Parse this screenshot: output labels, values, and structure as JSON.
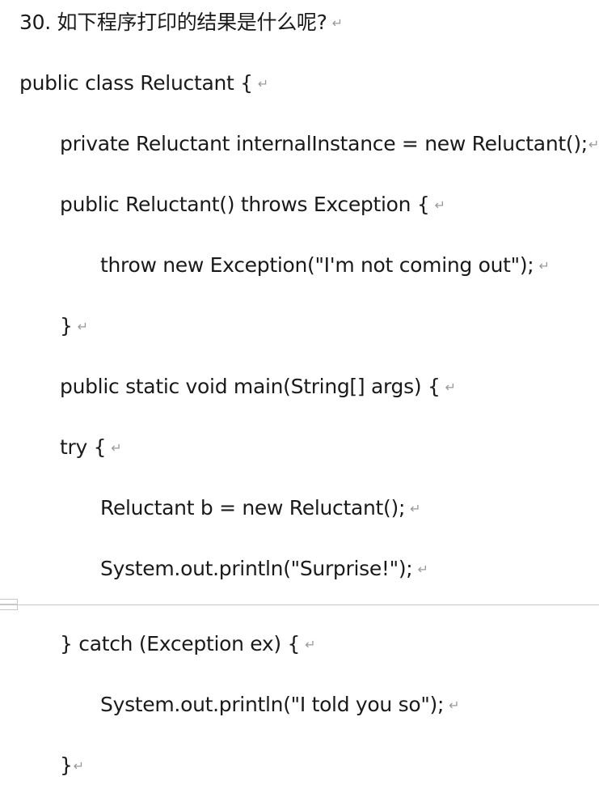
{
  "document": {
    "paragraph_mark": "↵",
    "lines": [
      {
        "text": "30. 如下程序打印的结果是什么呢?"
      },
      {
        "text": "public class Reluctant {"
      },
      {
        "text": "private Reluctant internalInstance = new Reluctant();"
      },
      {
        "text": "public Reluctant() throws Exception {"
      },
      {
        "text": "throw new Exception(\"I'm not coming out\");"
      },
      {
        "text": "}"
      },
      {
        "text": "public static void main(String[] args) {"
      },
      {
        "text": "try {"
      },
      {
        "text": "Reluctant b = new Reluctant();"
      },
      {
        "text": "System.out.println(\"Surprise!\");"
      },
      {
        "text": "} catch (Exception ex) {"
      },
      {
        "text": "System.out.println(\"I told you so\");"
      },
      {
        "text": "}"
      }
    ]
  }
}
